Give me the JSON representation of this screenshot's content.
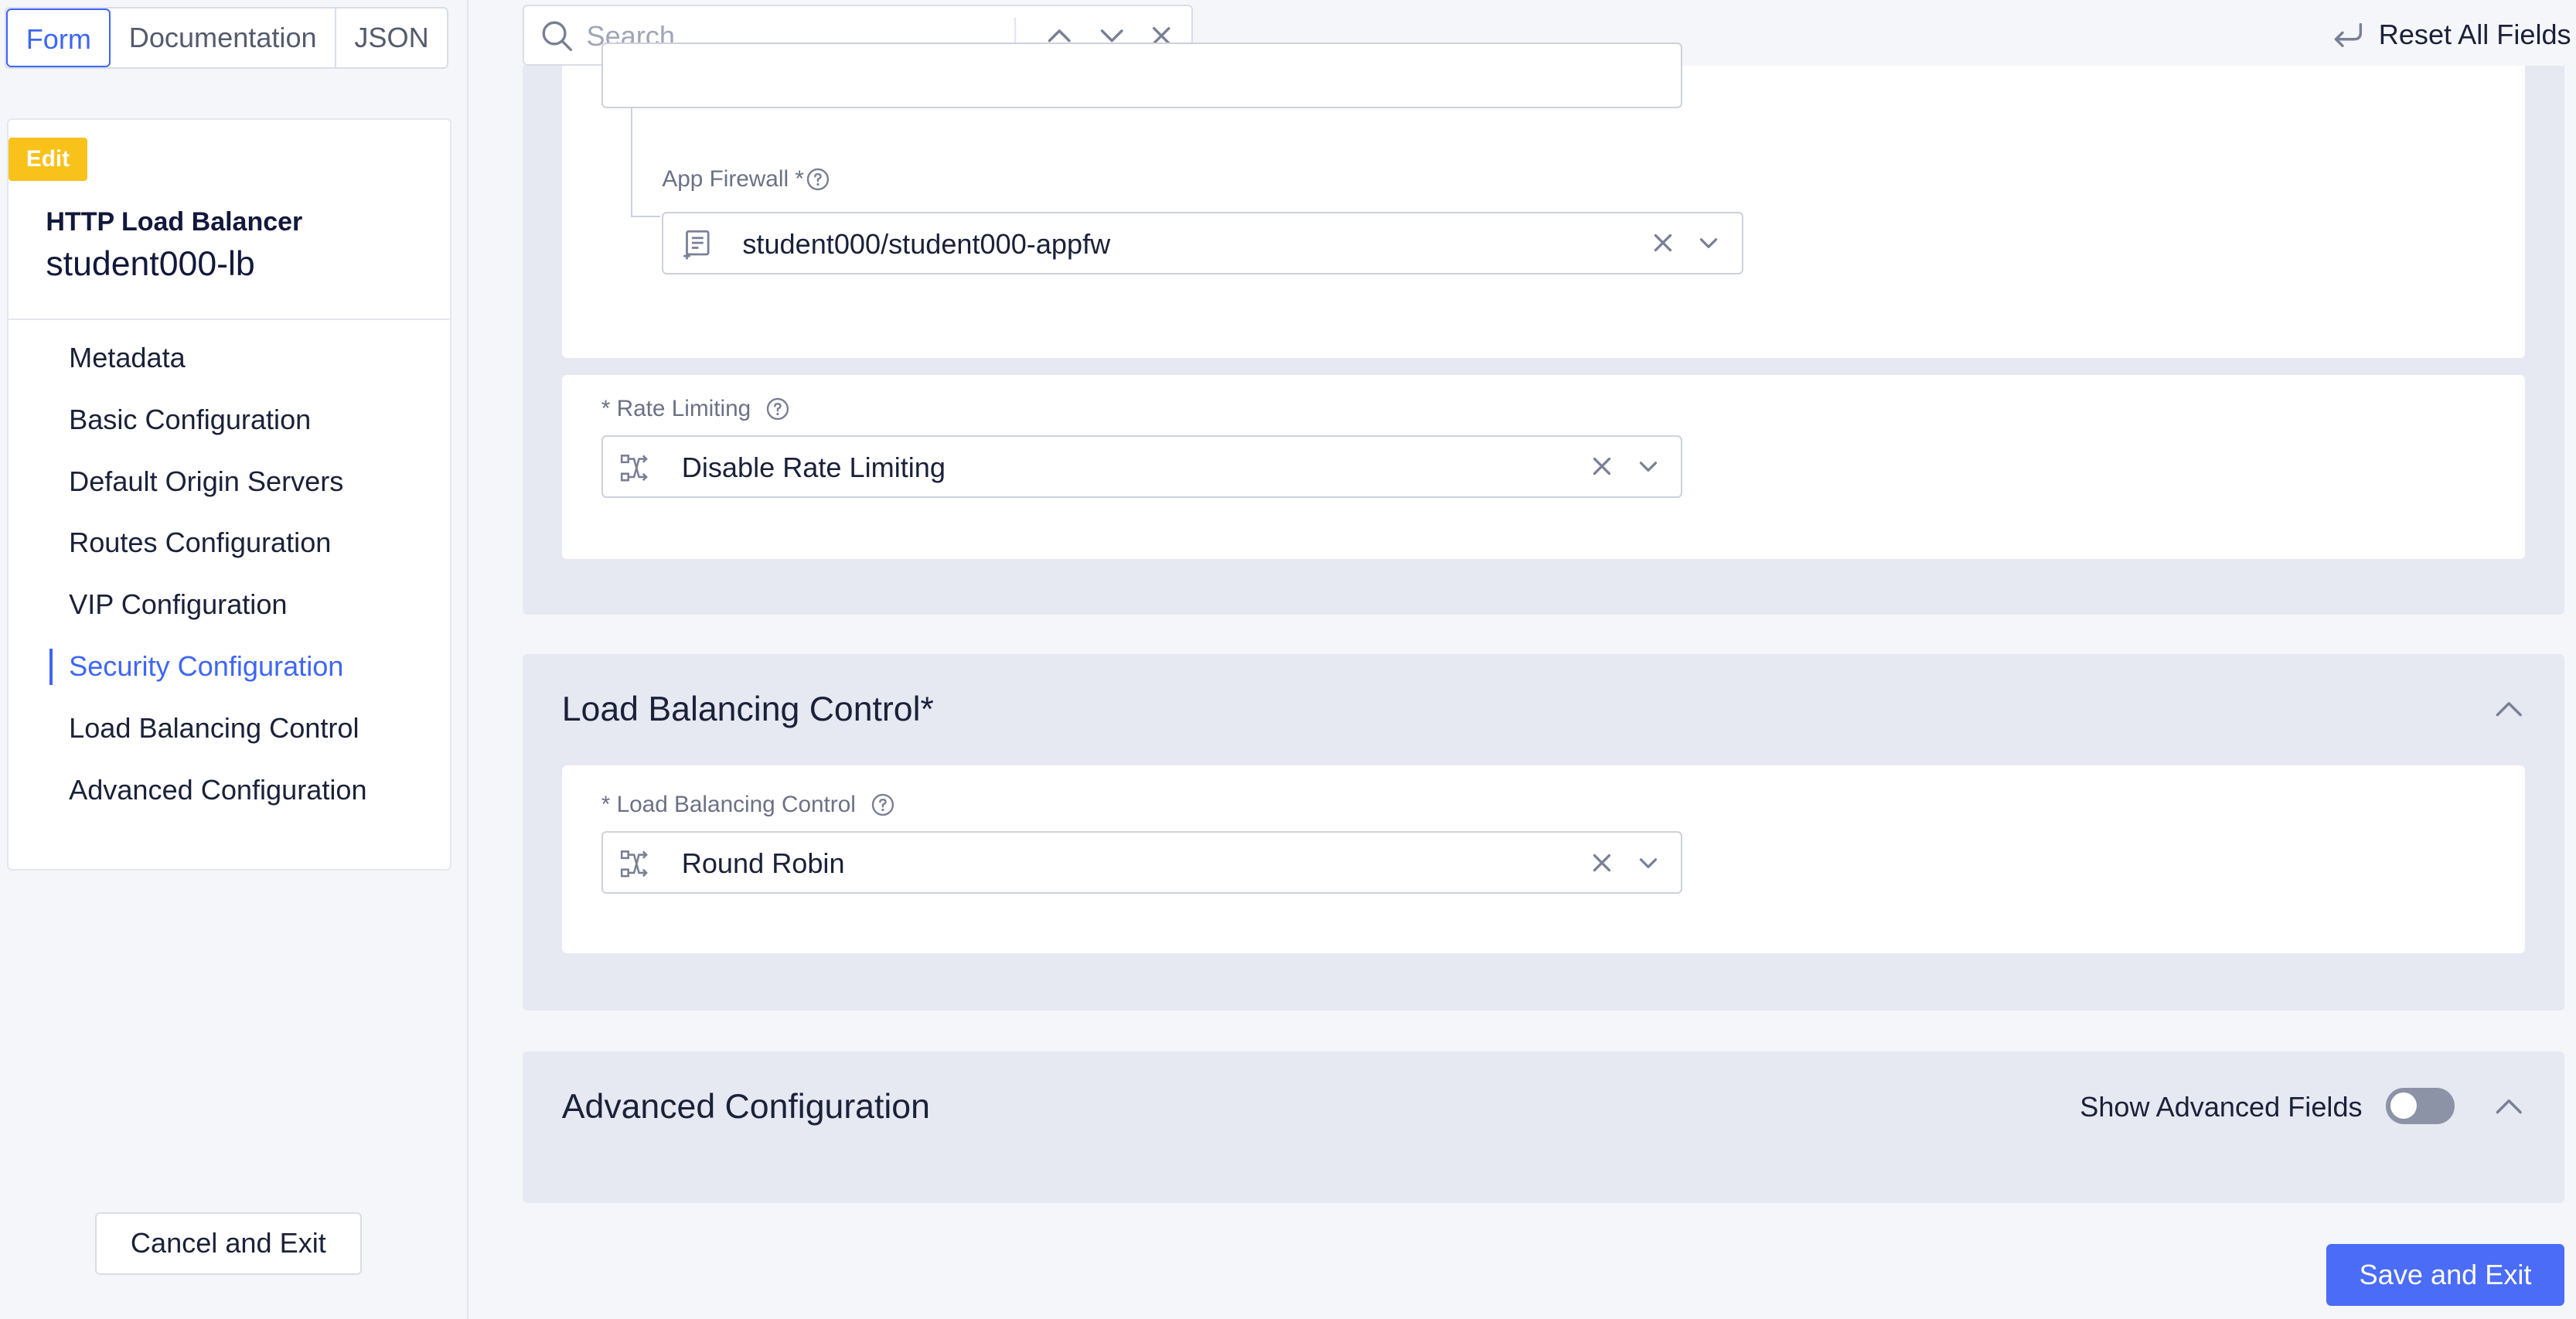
{
  "view_tabs": [
    "Form",
    "Documentation",
    "JSON"
  ],
  "active_view_tab": "Form",
  "sidebar": {
    "badge": "Edit",
    "object_kind": "HTTP Load Balancer",
    "object_name": "student000-lb",
    "nav_items": [
      {
        "label": "Metadata"
      },
      {
        "label": "Basic Configuration"
      },
      {
        "label": "Default Origin Servers"
      },
      {
        "label": "Routes Configuration"
      },
      {
        "label": "VIP Configuration"
      },
      {
        "label": "Security Configuration"
      },
      {
        "label": "Load Balancing Control"
      },
      {
        "label": "Advanced Configuration"
      }
    ],
    "active_nav": "Security Configuration",
    "cancel_label": "Cancel and Exit"
  },
  "search": {
    "placeholder": "Search",
    "value": ""
  },
  "reset_label": "Reset All Fields",
  "security": {
    "app_firewall": {
      "label": "App Firewall *",
      "value": "student000/student000-appfw"
    },
    "rate_limiting": {
      "label": "* Rate Limiting",
      "value": "Disable Rate Limiting"
    }
  },
  "load_balancing": {
    "title": "Load Balancing Control",
    "required_mark": "*",
    "field": {
      "label": "* Load Balancing Control",
      "value": "Round Robin"
    }
  },
  "advanced": {
    "title": "Advanced Configuration",
    "toggle_label": "Show Advanced Fields",
    "toggle_on": false
  },
  "save_label": "Save and Exit",
  "colors": {
    "accent": "#3f66f4",
    "badge": "#f8c21b",
    "save_button": "#4a6cf7",
    "section_bg": "#e6e8f2"
  }
}
